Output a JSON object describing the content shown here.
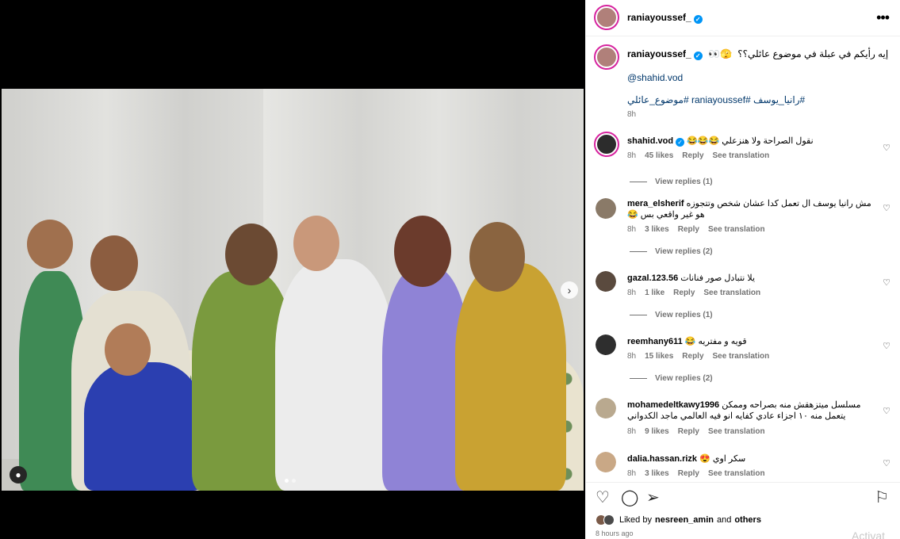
{
  "post": {
    "author": "raniayoussef_",
    "more_icon": "more-icon",
    "caption_text": "إيه رأيكم في عبلة في موضوع عائلي؟؟",
    "caption_emoji": "👀🫣",
    "mention": "@shahid.vod",
    "hashtags": "#رانيا_يوسف #raniayoussef #موضوع_عائلي",
    "caption_time": "8h"
  },
  "comments": [
    {
      "user": "shahid.vod",
      "text": "نقول الصراحة ولا هنزعلي 😂😂😂",
      "time": "8h",
      "likes": "45 likes",
      "reply": "Reply",
      "translate": "See translation",
      "view_replies": "View replies (1)",
      "avatar_color": "#2c2c2c"
    },
    {
      "user": "mera_elsherif",
      "text": "مش رانيا يوسف ال تعمل كدا عشان شخص وتتجوزه هو غير واقعي بس 😂",
      "time": "8h",
      "likes": "3 likes",
      "reply": "Reply",
      "translate": "See translation",
      "view_replies": "View replies (2)",
      "avatar_color": "#8a7a68"
    },
    {
      "user": "gazal.123.56",
      "text": "يلا نتبادل صور فنانات",
      "time": "8h",
      "likes": "1 like",
      "reply": "Reply",
      "translate": "See translation",
      "view_replies": "View replies (1)",
      "avatar_color": "#5a4a3e"
    },
    {
      "user": "reemhany611",
      "text": "قويه و مفتريه 😂",
      "time": "8h",
      "likes": "15 likes",
      "reply": "Reply",
      "translate": "See translation",
      "view_replies": "View replies (2)",
      "avatar_color": "#2e2e2e"
    },
    {
      "user": "mohamedeltkawy1996",
      "text": "مسلسل ميتزهقش منه بصراحه وممكن يتعمل منه ١٠ اجزاء عادي كفايه انو فيه العالمي ماجد الكدواني",
      "time": "8h",
      "likes": "9 likes",
      "reply": "Reply",
      "translate": "See translation",
      "view_replies": "",
      "avatar_color": "#b9a98f"
    },
    {
      "user": "dalia.hassan.rizk",
      "text": "سكر اوي 😍",
      "time": "8h",
      "likes": "3 likes",
      "reply": "Reply",
      "translate": "See translation",
      "view_replies": "",
      "avatar_color": "#c9a886"
    }
  ],
  "actions": {
    "like_icon": "heart-icon",
    "comment_icon": "comment-icon",
    "share_icon": "share-icon",
    "save_icon": "bookmark-icon"
  },
  "likes": {
    "prefix": "Liked by",
    "user": "nesreen_amin",
    "and": "and",
    "others": "others"
  },
  "posted_ago": "8 hours ago",
  "watermark": "Activat",
  "colors": {
    "link": "#00376b",
    "meta": "#737373",
    "verified": "#0095f6",
    "story_ring": "#d6249f"
  }
}
